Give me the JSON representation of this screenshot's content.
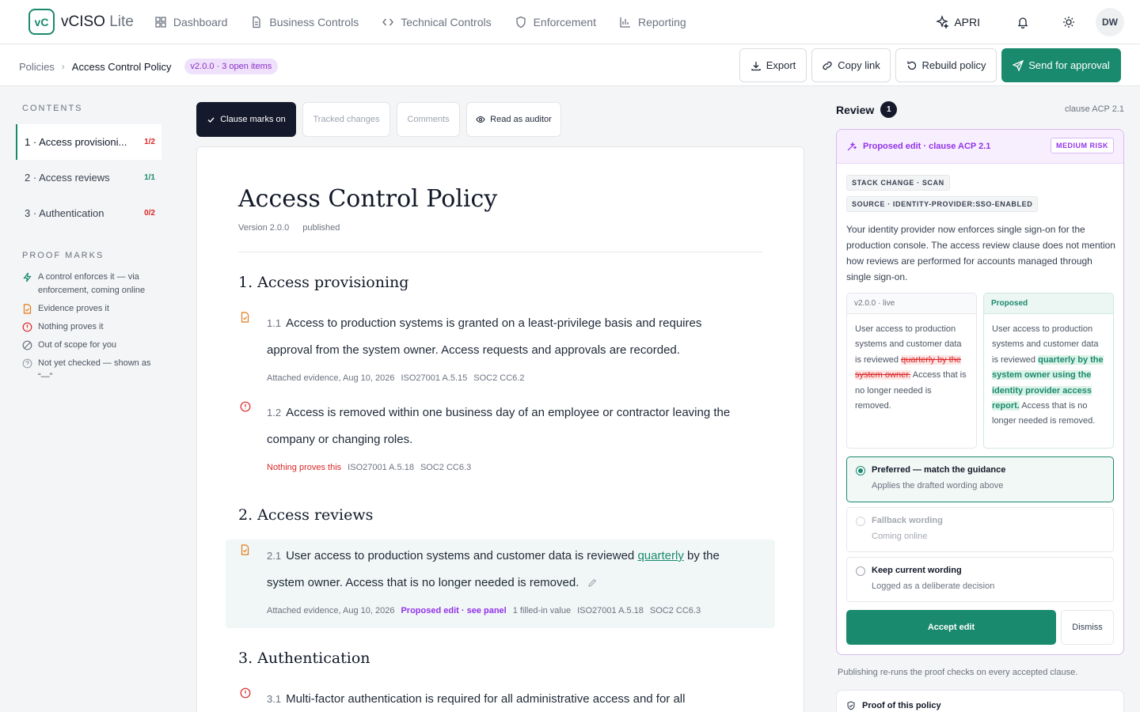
{
  "app": {
    "logo_mark": "vC",
    "name": "vCISO",
    "name_suffix": "Lite"
  },
  "nav": [
    {
      "label": "Dashboard",
      "icon": "grid-icon"
    },
    {
      "label": "Business Controls",
      "icon": "document-icon"
    },
    {
      "label": "Technical Controls",
      "icon": "code-icon"
    },
    {
      "label": "Enforcement",
      "icon": "shield-icon"
    },
    {
      "label": "Reporting",
      "icon": "bar-chart-icon"
    }
  ],
  "topright": {
    "apri_label": "APRI",
    "avatar_initials": "DW"
  },
  "breadcrumb": {
    "parent": "Policies",
    "current": "Access Control Policy",
    "version_badge": "v2.0.0 · 3 open items"
  },
  "actions": {
    "export": "Export",
    "copy_link": "Copy link",
    "rebuild": "Rebuild policy",
    "send": "Send for approval"
  },
  "sidebar": {
    "contents_heading": "CONTENTS",
    "toc": [
      {
        "label": "1 · Access provisioni...",
        "count": "1/2",
        "status": "red"
      },
      {
        "label": "2 · Access reviews",
        "count": "1/1",
        "status": "green"
      },
      {
        "label": "3 · Authentication",
        "count": "0/2",
        "status": "red"
      }
    ],
    "proof_heading": "PROOF MARKS",
    "proof_marks": [
      {
        "label": "A control enforces it — via enforcement, coming online",
        "icon": "bolt-icon"
      },
      {
        "label": "Evidence proves it",
        "icon": "evidence-doc-icon"
      },
      {
        "label": "Nothing proves it",
        "icon": "alert-circle-icon"
      },
      {
        "label": "Out of scope for you",
        "icon": "slash-circle-icon"
      },
      {
        "label": "Not yet checked — shown as “—”",
        "icon": "question-circle-icon"
      }
    ]
  },
  "toolbar": {
    "clause_marks": "Clause marks on",
    "tracked": "Tracked changes",
    "comments": "Comments",
    "auditor": "Read as auditor"
  },
  "doc": {
    "title": "Access Control Policy",
    "version": "Version 2.0.0",
    "status": "published",
    "sections": [
      {
        "heading": "1. Access provisioning"
      },
      {
        "heading": "2. Access reviews"
      },
      {
        "heading": "3. Authentication"
      }
    ],
    "clauses": [
      {
        "num": "1.1",
        "text": "Access to production systems is granted on a least-privilege basis and requires approval from the system owner. Access requests and approvals are recorded.",
        "evidence": "Attached evidence, Aug 10, 2026",
        "refs": [
          "ISO27001 A.5.15",
          "SOC2 CC6.2"
        ]
      },
      {
        "num": "1.2",
        "text": "Access is removed within one business day of an employee or contractor leaving the company or changing roles.",
        "evidence": "Nothing proves this",
        "refs": [
          "ISO27001 A.5.18",
          "SOC2 CC6.3"
        ]
      },
      {
        "num": "2.1",
        "text_a": "User access to production systems and customer data is reviewed",
        "text_link": "quarterly",
        "text_b": "by the system owner. Access that is no longer needed is removed.",
        "evidence": "Attached evidence, Aug 10, 2026",
        "proposed": "Proposed edit · see panel",
        "filled": "1 filled-in value",
        "refs": [
          "ISO27001 A.5.18",
          "SOC2 CC6.3"
        ]
      },
      {
        "num": "3.1",
        "text": "Multi-factor authentication is required for all administrative access and for all"
      }
    ]
  },
  "review": {
    "heading": "Review",
    "count": "1",
    "clause_ref": "clause ACP 2.1",
    "card_title": "Proposed edit · clause ACP 2.1",
    "risk": "MEDIUM RISK",
    "tag1": "STACK CHANGE · SCAN",
    "tag2": "SOURCE · IDENTITY-PROVIDER:SSO-ENABLED",
    "description": "Your identity provider now enforces single sign-on for the production console. The access review clause does not mention how reviews are performed for accounts managed through single sign-on.",
    "live_label": "v2.0.0 · live",
    "live_a": "User access to production systems and customer data is reviewed",
    "live_del": "quarterly by the system owner.",
    "live_b": "Access that is no longer needed is removed.",
    "prop_label": "Proposed",
    "prop_a": "User access to production systems and customer data is reviewed",
    "prop_ins": "quarterly by the system owner using the identity provider access report.",
    "prop_b": "Access that is no longer needed is removed.",
    "options": [
      {
        "title": "Preferred — match the guidance",
        "sub": "Applies the drafted wording above"
      },
      {
        "title": "Fallback wording",
        "sub": "Coming online"
      },
      {
        "title": "Keep current wording",
        "sub": "Logged as a deliberate decision"
      }
    ],
    "accept": "Accept edit",
    "dismiss": "Dismiss",
    "footnote": "Publishing re-runs the proof checks on every accepted clause.",
    "proof_card": "Proof of this policy"
  }
}
